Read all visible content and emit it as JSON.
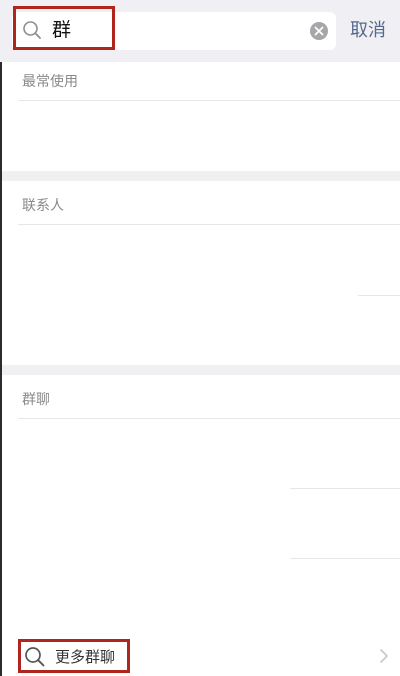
{
  "search": {
    "query": "群",
    "cancel_label": "取消"
  },
  "sections": {
    "frequent": {
      "title": "最常使用"
    },
    "contacts": {
      "title": "联系人"
    },
    "groups": {
      "title": "群聊"
    }
  },
  "more_groups": {
    "label": "更多群聊"
  },
  "colors": {
    "highlight": "#b0261e",
    "cancel": "#556b8d"
  }
}
